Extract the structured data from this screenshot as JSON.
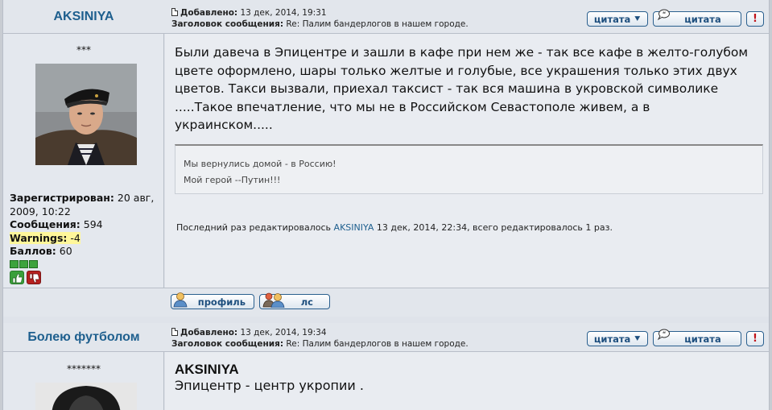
{
  "posts": [
    {
      "author": "AKSINIYA",
      "rank": "***",
      "meta": {
        "added_label": "Добавлено:",
        "added_value": "13 дек, 2014, 19:31",
        "subject_label": "Заголовок сообщения:",
        "subject_value": "Re: Палим бандерлогов в нашем городе."
      },
      "buttons": {
        "quote": "цитата",
        "quote_multi": "цитата",
        "report": "!"
      },
      "profile": {
        "registered_label": "Зарегистрирован:",
        "registered_value": "20 авг, 2009, 10:22",
        "posts_label": "Сообщения:",
        "posts_value": "594",
        "warnings_label": "Warnings:",
        "warnings_value": "-4",
        "points_label": "Баллов:",
        "points_value": "60"
      },
      "message": "Были давеча в Эпицентре и зашли в кафе при нем же - так все кафе в желто-голубом цвете оформлено, шары только желтые и голубые, все украшения только этих двух цветов. Такси вызвали, приехал таксист - так вся машина в укровской символике .....Такое впечатление, что мы не в Российском Севастополе живем, а в украинском.....",
      "signature_line1": "Мы вернулись домой - в Россию!",
      "signature_line2": "Мой герой --Путин!!!",
      "edited_prefix": "Последний раз редактировалось",
      "edited_user": "AKSINIYA",
      "edited_suffix": "13 дек, 2014, 22:34, всего редактировалось 1 раз.",
      "footer": {
        "profile": "профиль",
        "pm": "лс"
      }
    },
    {
      "author": "Болею футболом",
      "rank": "*******",
      "meta": {
        "added_label": "Добавлено:",
        "added_value": "13 дек, 2014, 19:34",
        "subject_label": "Заголовок сообщения:",
        "subject_value": "Re: Палим бандерлогов в нашем городе."
      },
      "buttons": {
        "quote": "цитата",
        "quote_multi": "цитата",
        "report": "!"
      },
      "quote_author": "AKSINIYA",
      "message": "Эпицентр - центр укропии ."
    }
  ],
  "colors": {
    "accent": "#1e5f8e",
    "panel": "#e2e6ec",
    "warning_highlight": "#fff79a",
    "report": "#c0141a"
  },
  "icons": [
    "document-icon",
    "chevron-down-icon",
    "speech-balloon-icon",
    "exclamation-icon",
    "thumbs-up-icon",
    "thumbs-down-icon",
    "user-icon",
    "users-icon"
  ]
}
